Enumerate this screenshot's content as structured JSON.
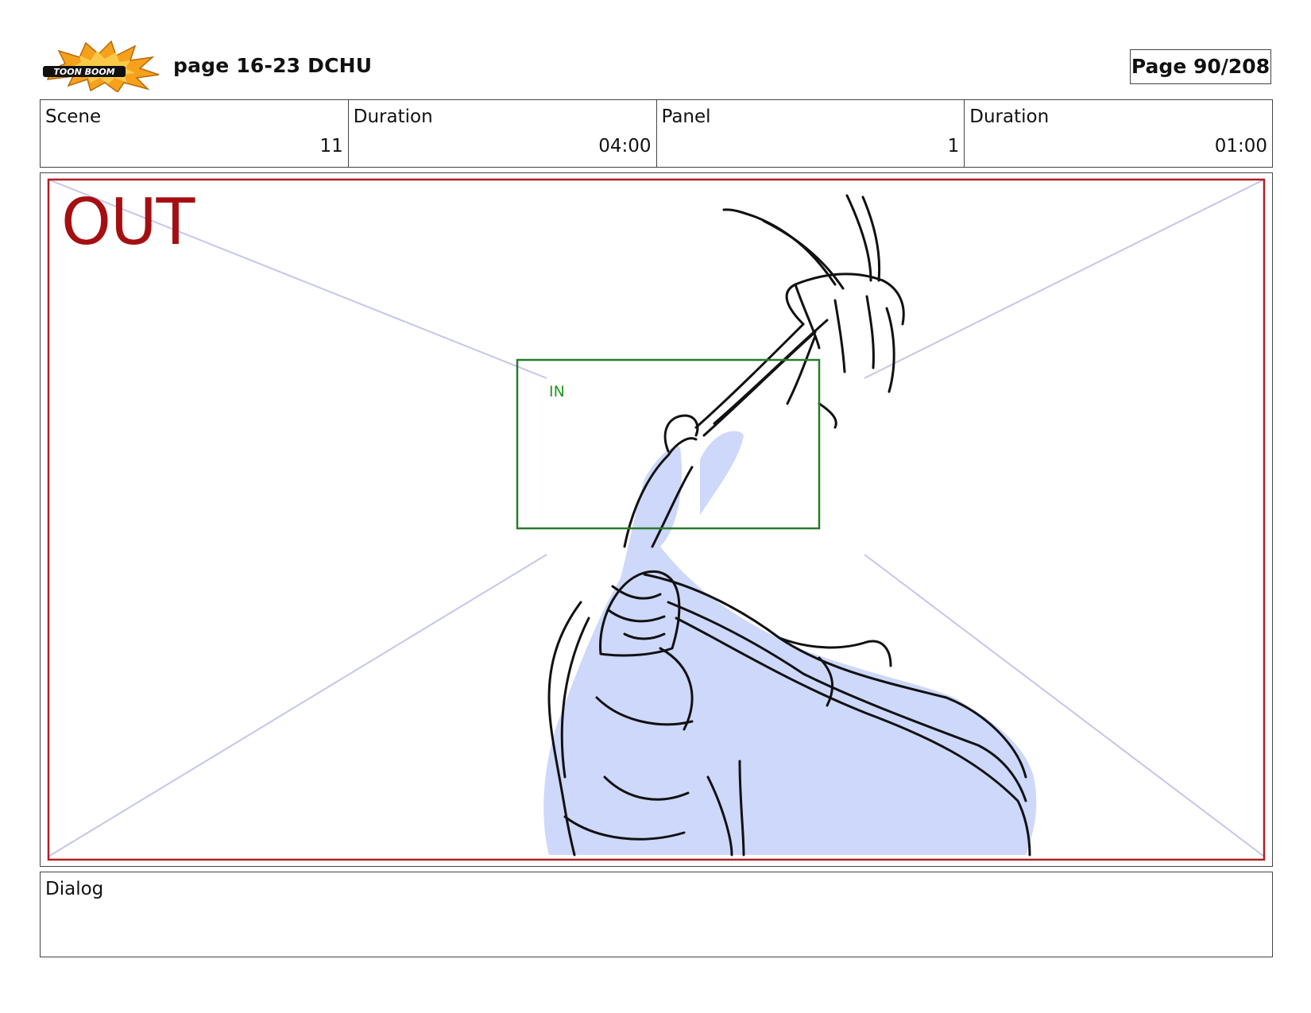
{
  "header": {
    "logo_text": "TOON BOOM",
    "title": "page 16-23 DCHU",
    "page_counter": "Page  90/208"
  },
  "info": {
    "scene_label": "Scene",
    "scene_value": "11",
    "scene_duration_label": "Duration",
    "scene_duration_value": "04:00",
    "panel_label": "Panel",
    "panel_value": "1",
    "panel_duration_label": "Duration",
    "panel_duration_value": "01:00"
  },
  "panel": {
    "out_label": "OUT",
    "in_label": "IN",
    "colors": {
      "out_frame": "#b11f24",
      "in_frame": "#2a7a2a",
      "guide_lines": "#c6c6ec",
      "fill": "#cdd8fb",
      "ink": "#111111"
    }
  },
  "dialog": {
    "label": "Dialog",
    "text": ""
  }
}
